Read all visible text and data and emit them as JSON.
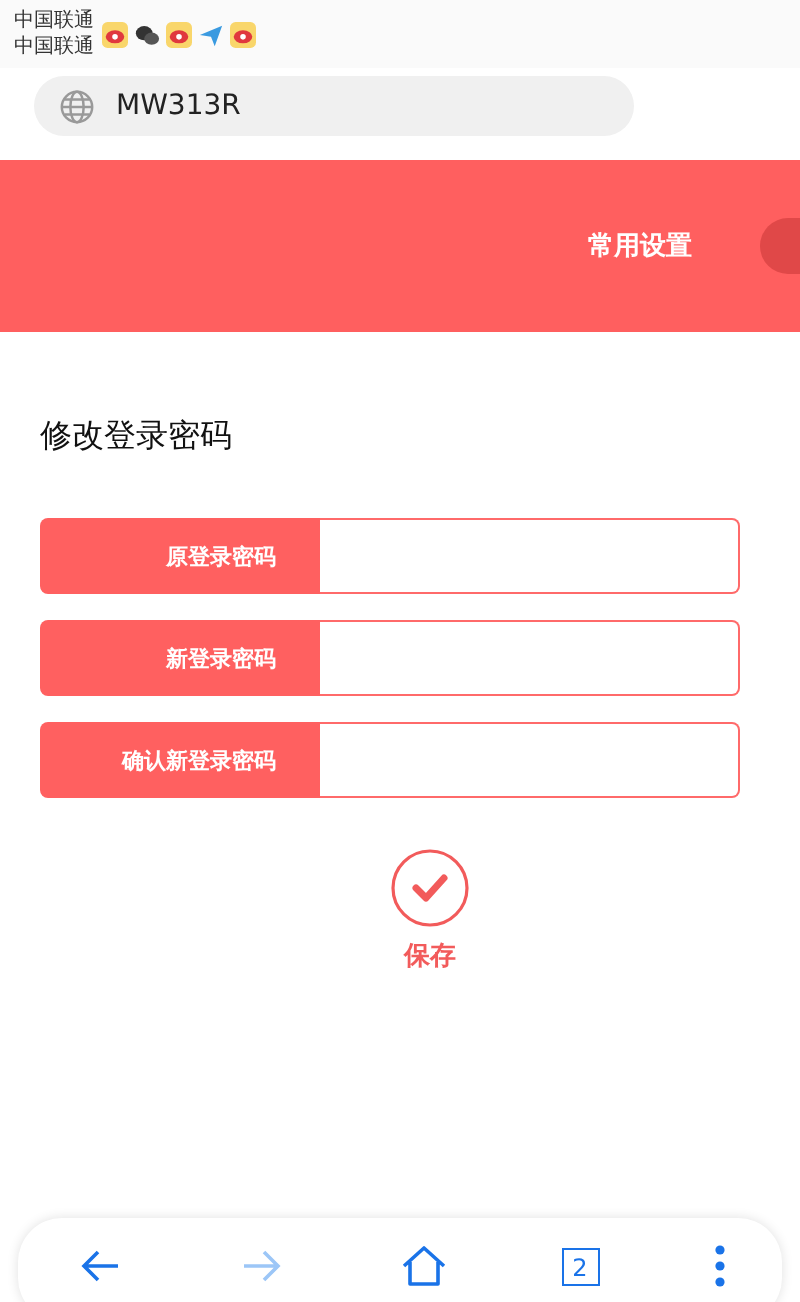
{
  "status_bar": {
    "carriers": [
      "中国联通",
      "中国联通"
    ]
  },
  "address_bar": {
    "url": "MW313R"
  },
  "nav": {
    "tabs": [
      {
        "label": "常用设置",
        "selected": false
      },
      {
        "selected": true
      }
    ]
  },
  "form": {
    "title": "修改登录密码",
    "fields": [
      {
        "label": "原登录密码"
      },
      {
        "label": "新登录密码"
      },
      {
        "label": "确认新登录密码"
      }
    ],
    "save_button": {
      "label": "保存"
    }
  },
  "browser_toolbar": {
    "back": {
      "disabled": false
    },
    "forward": {
      "disabled": true
    },
    "tab_count": "2"
  }
}
